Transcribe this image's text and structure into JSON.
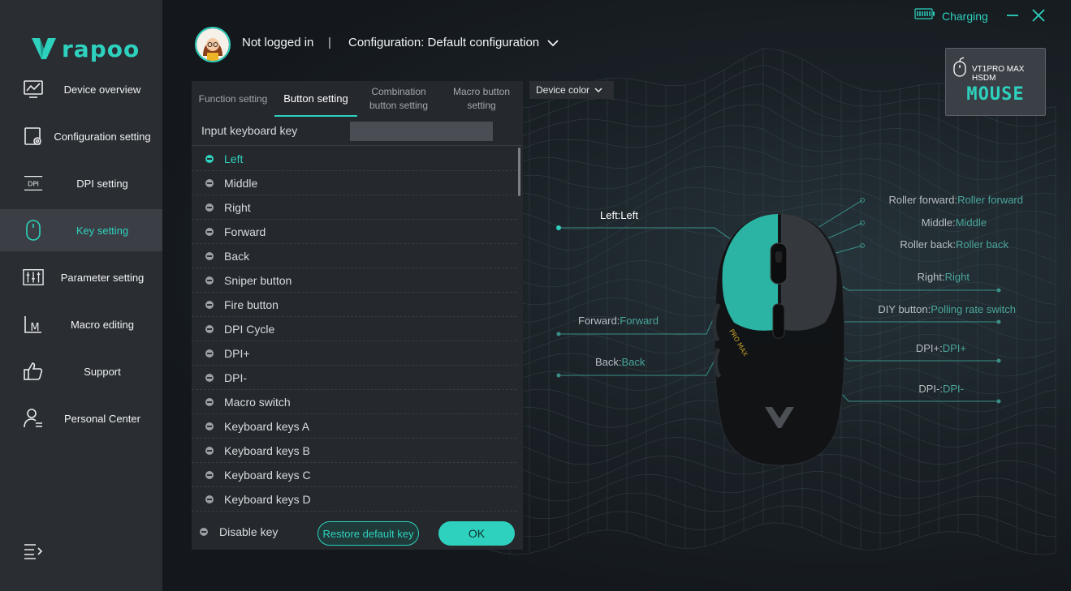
{
  "brand": {
    "name": "rapoo",
    "accent": "#2ed1bd"
  },
  "sidebar": {
    "items": [
      {
        "label": "Device overview",
        "icon": "monitor-chart-icon"
      },
      {
        "label": "Configuration setting",
        "icon": "config-gear-icon"
      },
      {
        "label": "DPI setting",
        "icon": "dpi-icon"
      },
      {
        "label": "Key setting",
        "icon": "mouse-icon",
        "active": true
      },
      {
        "label": "Parameter setting",
        "icon": "sliders-icon"
      },
      {
        "label": "Macro editing",
        "icon": "macro-icon"
      },
      {
        "label": "Support",
        "icon": "thumbs-up-icon"
      },
      {
        "label": "Personal Center",
        "icon": "user-list-icon"
      }
    ],
    "collapse_icon": "menu-collapse-icon"
  },
  "header": {
    "login_status": "Not logged in",
    "separator": "|",
    "configuration": "Configuration: Default configuration"
  },
  "status": {
    "charging": "Charging"
  },
  "device": {
    "model": "VT1PRO MAX HSDM",
    "type": "MOUSE"
  },
  "panel": {
    "tabs": [
      {
        "label": "Function setting"
      },
      {
        "label": "Button setting",
        "active": true
      },
      {
        "label": "Combination button setting"
      },
      {
        "label": "Macro button setting"
      }
    ],
    "keyboard_input_label": "Input keyboard key",
    "keyboard_input_value": "",
    "keys": [
      {
        "label": "Left",
        "selected": true
      },
      {
        "label": "Middle"
      },
      {
        "label": "Right"
      },
      {
        "label": "Forward"
      },
      {
        "label": "Back"
      },
      {
        "label": "Sniper button"
      },
      {
        "label": "Fire button"
      },
      {
        "label": "DPI Cycle"
      },
      {
        "label": "DPI+"
      },
      {
        "label": "DPI-"
      },
      {
        "label": "Macro switch"
      },
      {
        "label": "Keyboard keys A"
      },
      {
        "label": "Keyboard keys B"
      },
      {
        "label": "Keyboard keys C"
      },
      {
        "label": "Keyboard keys D"
      }
    ],
    "disable_key": "Disable key",
    "restore_button": "Restore default key",
    "ok_button": "OK"
  },
  "device_color": "Device color",
  "callouts": {
    "left": {
      "name": "Left:",
      "value": "Left"
    },
    "forward": {
      "name": "Forward:",
      "value": "Forward"
    },
    "back": {
      "name": "Back:",
      "value": "Back"
    },
    "roller_forward": {
      "name": "Roller forward:",
      "value": "Roller forward"
    },
    "middle": {
      "name": "Middle:",
      "value": "Middle"
    },
    "roller_back": {
      "name": "Roller back:",
      "value": "Roller back"
    },
    "right": {
      "name": "Right:",
      "value": "Right"
    },
    "diy": {
      "name": "DIY button:",
      "value": "Polling rate switch"
    },
    "dpi_plus": {
      "name": "DPI+:",
      "value": "DPI+"
    },
    "dpi_minus": {
      "name": "DPI-:",
      "value": "DPI-"
    }
  },
  "mouse_print": "PRO MAX"
}
